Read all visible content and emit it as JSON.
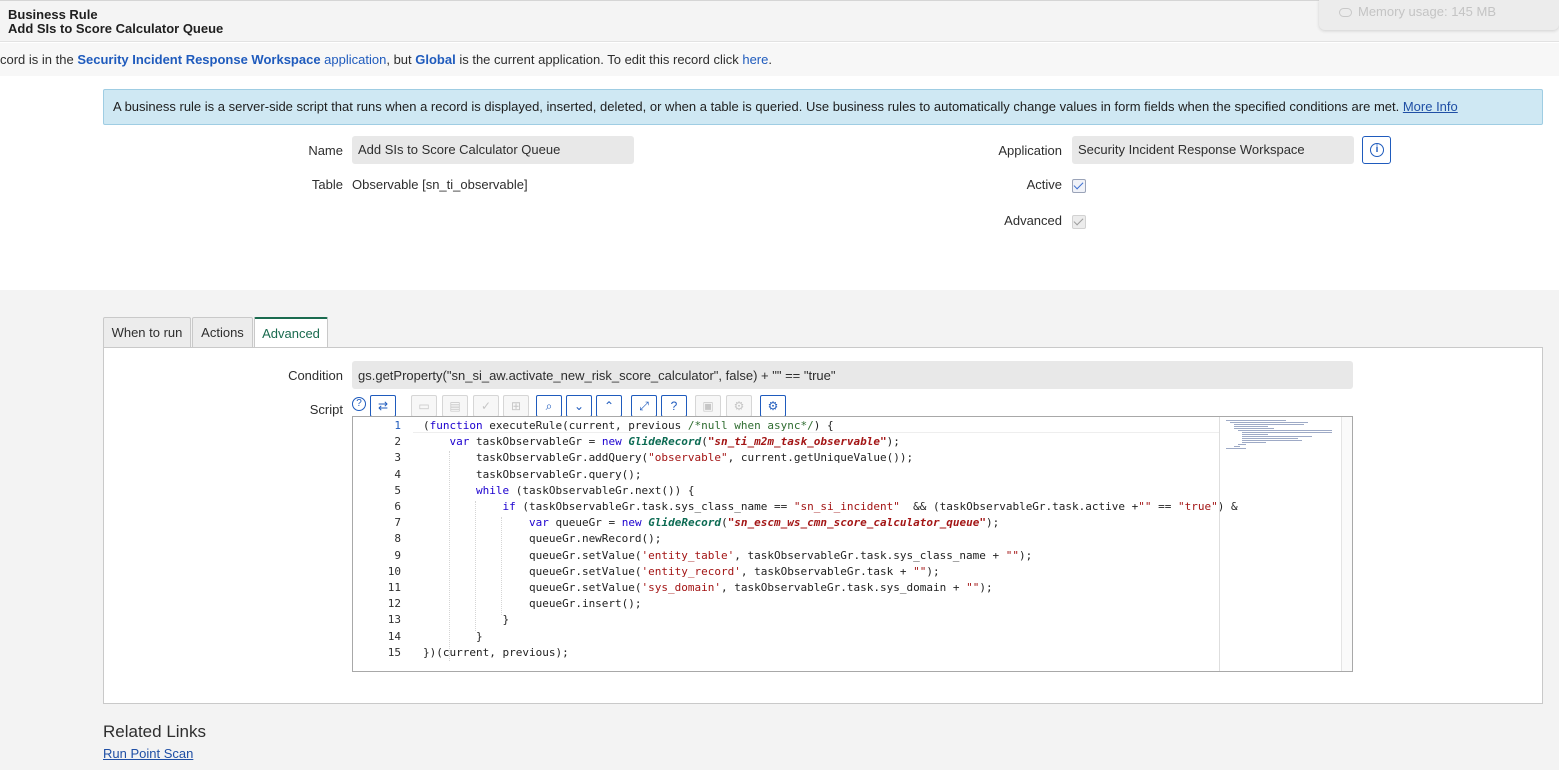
{
  "header": {
    "record_type": "Business Rule",
    "record_name": "Add SIs to Score Calculator Queue",
    "memory_usage": "Memory usage: 145 MB"
  },
  "notice": {
    "prefix": "cord is in the ",
    "app_link": "Security Incident Response Workspace",
    "app_suffix": " application",
    "middle": ", but ",
    "scope": "Global",
    "middle2": " is the current application. To edit this record click ",
    "here_link": "here",
    "end": "."
  },
  "info_box": {
    "text": "A business rule is a server-side script that runs when a record is displayed, inserted, deleted, or when a table is queried. Use business rules to automatically change values in form fields when the specified conditions are met. ",
    "more_info": "More Info"
  },
  "form": {
    "name_label": "Name",
    "name_value": "Add SIs to Score Calculator Queue",
    "table_label": "Table",
    "table_value": "Observable [sn_ti_observable]",
    "application_label": "Application",
    "application_value": "Security Incident Response Workspace",
    "active_label": "Active",
    "active_checked": true,
    "advanced_label": "Advanced",
    "advanced_checked": true
  },
  "tabs": [
    {
      "label": "When to run",
      "active": false
    },
    {
      "label": "Actions",
      "active": false
    },
    {
      "label": "Advanced",
      "active": true
    }
  ],
  "advanced": {
    "condition_label": "Condition",
    "condition_value": "gs.getProperty(\"sn_si_aw.activate_new_risk_score_calculator\", false) + \"\" == \"true\"",
    "script_label": "Script",
    "help_glyph": "?"
  },
  "toolbar_icons": [
    {
      "name": "toggle-syntax-editor-icon",
      "enabled": true,
      "glyph": "⇄"
    },
    {
      "name": "comment-selected-icon",
      "enabled": false,
      "glyph": "▭"
    },
    {
      "name": "uncomment-selected-icon",
      "enabled": false,
      "glyph": "▤"
    },
    {
      "name": "check-syntax-icon",
      "enabled": false,
      "glyph": "✓"
    },
    {
      "name": "format-code-icon",
      "enabled": false,
      "glyph": "⊞"
    },
    {
      "name": "search-icon",
      "enabled": true,
      "glyph": "⌕"
    },
    {
      "name": "find-next-icon",
      "enabled": true,
      "glyph": "⌄"
    },
    {
      "name": "find-previous-icon",
      "enabled": true,
      "glyph": "⌃"
    },
    {
      "name": "full-screen-icon",
      "enabled": true,
      "glyph": "⤢"
    },
    {
      "name": "help-icon",
      "enabled": true,
      "glyph": "?"
    },
    {
      "name": "save-icon",
      "enabled": false,
      "glyph": "▣"
    },
    {
      "name": "script-debugger-icon",
      "enabled": false,
      "glyph": "⚙"
    },
    {
      "name": "script-settings-icon",
      "enabled": true,
      "glyph": "⚙"
    }
  ],
  "script_lines": [
    "(function executeRule(current, previous /*null when async*/) {",
    "    var taskObservableGr = new GlideRecord(\"sn_ti_m2m_task_observable\");",
    "        taskObservableGr.addQuery(\"observable\", current.getUniqueValue());",
    "        taskObservableGr.query();",
    "        while (taskObservableGr.next()) {",
    "            if (taskObservableGr.task.sys_class_name == \"sn_si_incident\"  && (taskObservableGr.task.active +\"\" == \"true\") &",
    "                var queueGr = new GlideRecord(\"sn_escm_ws_cmn_score_calculator_queue\");",
    "                queueGr.newRecord();",
    "                queueGr.setValue('entity_table', taskObservableGr.task.sys_class_name + \"\");",
    "                queueGr.setValue('entity_record', taskObservableGr.task + \"\");",
    "                queueGr.setValue('sys_domain', taskObservableGr.task.sys_domain + \"\");",
    "                queueGr.insert();",
    "            }",
    "        }",
    "})(current, previous);"
  ],
  "line_numbers": [
    "1",
    "2",
    "3",
    "4",
    "5",
    "6",
    "7",
    "8",
    "9",
    "10",
    "11",
    "12",
    "13",
    "14",
    "15"
  ],
  "related": {
    "title": "Related Links",
    "link": "Run Point Scan"
  },
  "colors": {
    "accent": "#1f5bbd",
    "active_tab": "#1a6b4f",
    "info_bg": "#cfe8f3"
  }
}
